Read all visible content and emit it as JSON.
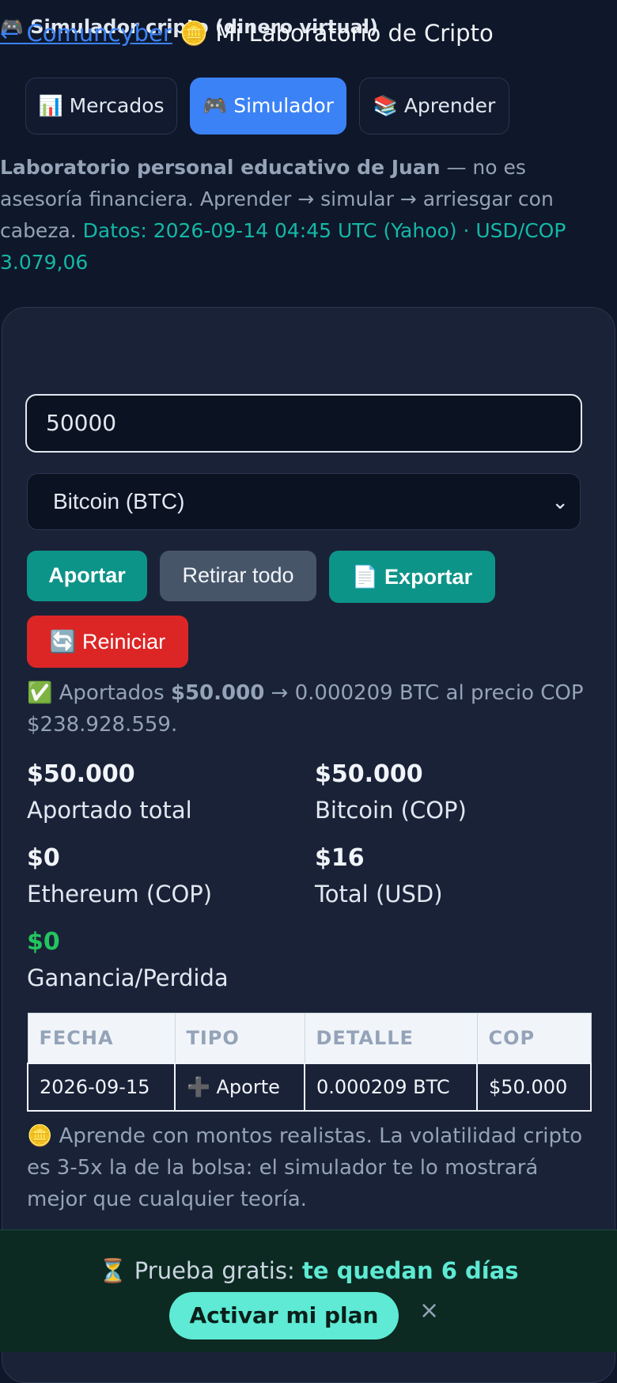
{
  "header": {
    "back_link": "← Comuncyber",
    "app_icon": "🪙",
    "title": "Mi Laboratorio de Cripto"
  },
  "tabs": [
    {
      "icon": "📊",
      "label": "Mercados",
      "active": false
    },
    {
      "icon": "🎮",
      "label": "Simulador",
      "active": true
    },
    {
      "icon": "📚",
      "label": "Aprender",
      "active": false
    }
  ],
  "intro": {
    "bold": "Laboratorio personal educativo de Juan",
    "text": " — no es asesoría financiera. Aprender → simular → arriesgar con cabeza. ",
    "data_info": "Datos: 2026-09-14 04:45 UTC (Yahoo) · USD/COP 3.079,06"
  },
  "simulator": {
    "title": "🎮 Simulador cripto (dinero virtual)",
    "amount_value": "50000",
    "asset_selected": "Bitcoin (BTC)",
    "buttons": {
      "contribute": "Aportar",
      "withdraw_all": "Retirar todo",
      "export": "📄 Exportar",
      "reset": "🔄 Reiniciar"
    },
    "message": {
      "prefix": "✅ Aportados ",
      "amount": "$50.000",
      "suffix": " → 0.000209 BTC al precio COP $238.928.559."
    },
    "stats": [
      {
        "value": "$50.000",
        "label": "Aportado total"
      },
      {
        "value": "$50.000",
        "label": "Bitcoin (COP)"
      },
      {
        "value": "$0",
        "label": "Ethereum (COP)"
      },
      {
        "value": "$16",
        "label": "Total (USD)"
      },
      {
        "value": "$0",
        "label": "Ganancia/Perdida"
      }
    ],
    "table": {
      "headers": [
        "FECHA",
        "TIPO",
        "DETALLE",
        "COP"
      ],
      "rows": [
        [
          "2026-09-15",
          "➕ Aporte",
          "0.000209 BTC",
          "$50.000"
        ]
      ]
    },
    "note": "🪙 Aprende con montos realistas. La volatilidad cripto es 3-5x la de la bolsa: el simulador te lo mostrará mejor que cualquier teoría."
  },
  "footer": {
    "trial_prefix": "⏳ Prueba gratis: ",
    "trial_days": "te quedan 6 días",
    "activate_label": "Activar mi plan",
    "close_label": "×"
  },
  "colors": {
    "background": "#0f172a",
    "card": "#1a2238",
    "accent_blue": "#3b82f6",
    "teal": "#0d9488",
    "red": "#dc2626",
    "gain_green": "#22c55e",
    "trial_highlight": "#5eead4"
  }
}
